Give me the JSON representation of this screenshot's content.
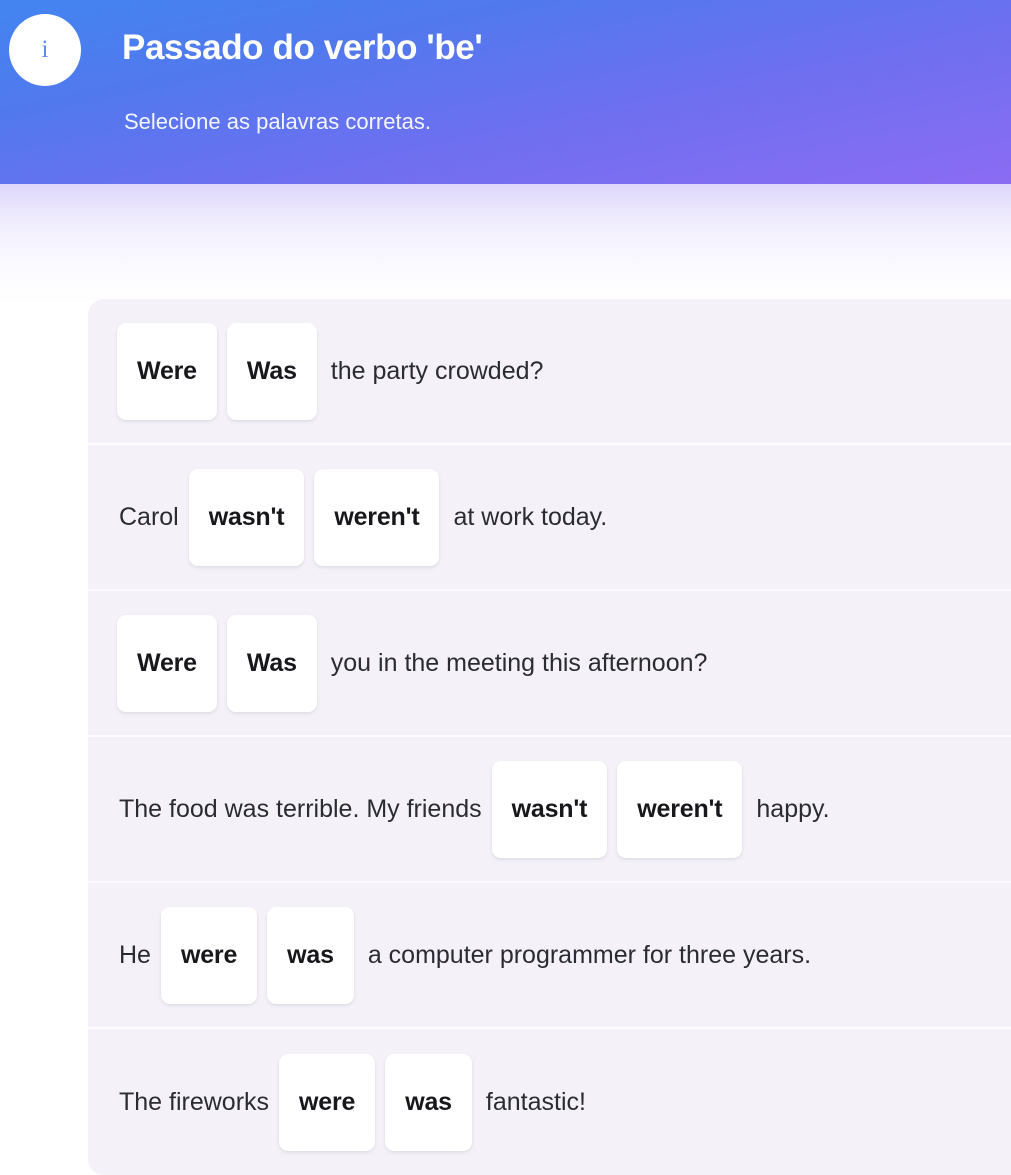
{
  "header": {
    "icon": "info-icon",
    "icon_glyph": "i",
    "title": "Passado do verbo 'be'",
    "subtitle": "Selecione as palavras corretas.",
    "gradient_from": "#4285f0",
    "gradient_to": "#8b6cf3",
    "icon_color": "#5b8df5"
  },
  "exercise": {
    "card_bg": "#f4f2f8",
    "chip_bg": "#ffffff",
    "text_color": "#2b2b33",
    "questions": [
      {
        "id": 1,
        "lead_text": "",
        "options": [
          "Were",
          "Was"
        ],
        "trail_text": "the party crowded?"
      },
      {
        "id": 2,
        "lead_text": "Carol",
        "options": [
          "wasn't",
          "weren't"
        ],
        "trail_text": "at work today."
      },
      {
        "id": 3,
        "lead_text": "",
        "options": [
          "Were",
          "Was"
        ],
        "trail_text": "you in the meeting this afternoon?"
      },
      {
        "id": 4,
        "lead_text": "The food was terrible. My friends",
        "options": [
          "wasn't",
          "weren't"
        ],
        "trail_text": "happy."
      },
      {
        "id": 5,
        "lead_text": "He",
        "options": [
          "were",
          "was"
        ],
        "trail_text": "a computer programmer for three years."
      },
      {
        "id": 6,
        "lead_text": "The fireworks",
        "options": [
          "were",
          "was"
        ],
        "trail_text": "fantastic!"
      }
    ]
  }
}
